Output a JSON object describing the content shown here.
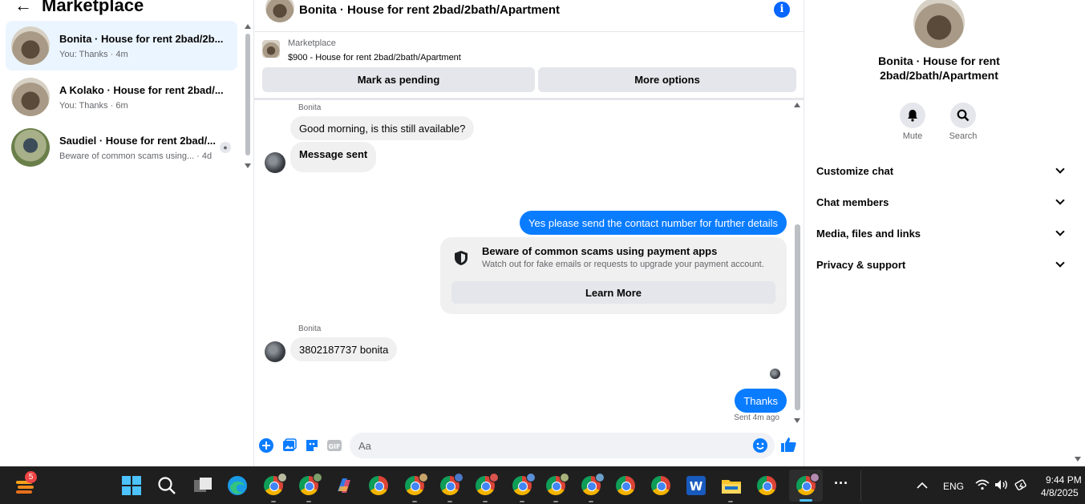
{
  "left_panel": {
    "title": "Marketplace",
    "conversations": [
      {
        "title": "Bonita · House for rent 2bad/2b...",
        "subtitle": "You: Thanks · 4m",
        "active": true
      },
      {
        "title": "A Kolako · House for rent 2bad/...",
        "subtitle": "You: Thanks · 6m",
        "active": false
      },
      {
        "title": "Saudiel · House for rent 2bad/...",
        "subtitle": "Beware of common scams using... · 4d",
        "active": false
      }
    ]
  },
  "chat": {
    "header_name": "Bonita · House for rent 2bad/2bath/Apartment",
    "info_icon": "i",
    "marketplace_label": "Marketplace",
    "listing_title": "$900 - House for rent 2bad/2bath/Apartment",
    "mark_pending": "Mark as pending",
    "more_options": "More options",
    "messages": {
      "sender1": "Bonita",
      "m1": "Good morning, is this still available?",
      "m2": "Message sent",
      "m3": "Yes please send the contact number for further details",
      "scam_title": "Beware of common scams using payment apps",
      "scam_body": "Watch out for fake emails or requests to upgrade your payment account.",
      "learn_more": "Learn More",
      "sender2": "Bonita",
      "m4": "3802187737 bonita",
      "m5": "Thanks",
      "sent_status": "Sent 4m ago"
    },
    "composer_placeholder": "Aa"
  },
  "right_panel": {
    "name": "Bonita · House for rent 2bad/2bath/Apartment",
    "mute_label": "Mute",
    "search_label": "Search",
    "sections": [
      "Customize chat",
      "Chat members",
      "Media, files and links",
      "Privacy & support"
    ]
  },
  "taskbar": {
    "notification_count": "5",
    "language": "ENG",
    "time": "9:44 PM",
    "date": "4/8/2025"
  },
  "colors": {
    "accent": "#0a7cff",
    "active_bg": "#ebf5ff",
    "taskbar": "#1f1f1f"
  }
}
